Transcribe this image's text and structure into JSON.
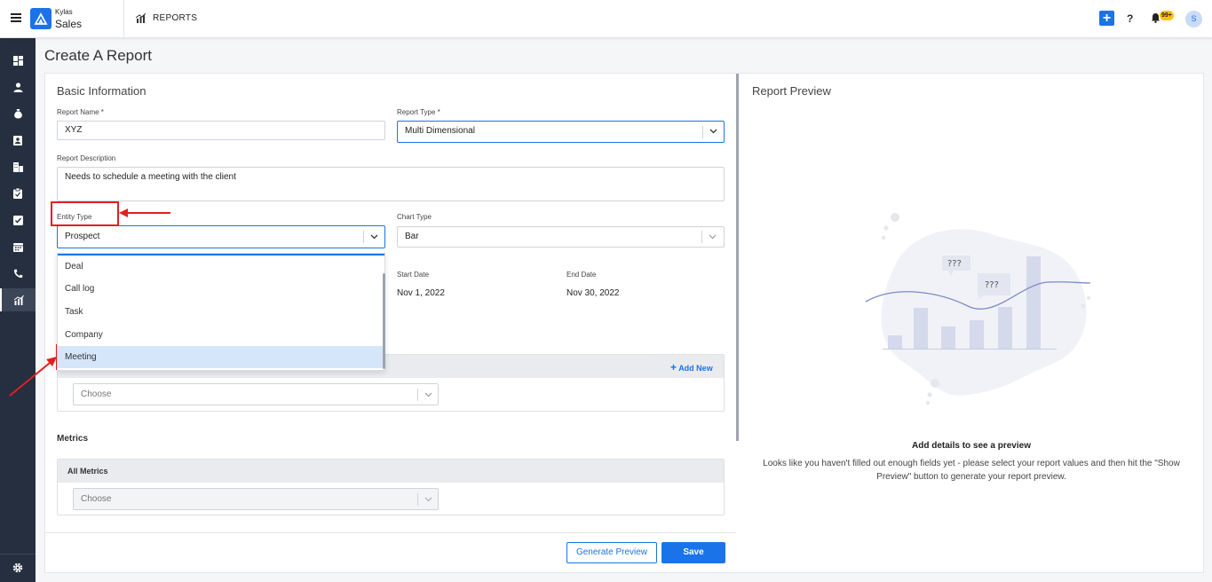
{
  "app": {
    "brand_top": "Kylas",
    "brand_main": "Sales",
    "module_title": "REPORTS",
    "notification_count": "99+",
    "avatar_initial": "S"
  },
  "sidebar": {
    "items": [
      {
        "name": "dashboard-icon"
      },
      {
        "name": "user-icon"
      },
      {
        "name": "money-bag-icon"
      },
      {
        "name": "contact-card-icon"
      },
      {
        "name": "building-icon"
      },
      {
        "name": "clipboard-icon"
      },
      {
        "name": "checkbox-icon"
      },
      {
        "name": "calendar-icon"
      },
      {
        "name": "phone-icon"
      },
      {
        "name": "reports-icon",
        "active": true
      }
    ],
    "bottom": "gear-icon"
  },
  "page": {
    "title": "Create A Report"
  },
  "basic_info": {
    "section_title": "Basic Information",
    "report_name_label": "Report Name *",
    "report_name_value": "XYZ",
    "report_type_label": "Report Type *",
    "report_type_value": "Multi Dimensional",
    "description_label": "Report Description",
    "description_value": "Needs to schedule a meeting with the client",
    "entity_type_label": "Entity Type",
    "entity_type_value": "Prospect",
    "chart_type_label": "Chart Type",
    "chart_type_value": "Bar",
    "start_date_label": "Start Date",
    "start_date_value": "Nov 1, 2022",
    "end_date_label": "End Date",
    "end_date_value": "Nov 30, 2022"
  },
  "entity_dropdown": {
    "options": [
      "Deal",
      "Call log",
      "Task",
      "Company",
      "Meeting"
    ],
    "highlighted": "Meeting"
  },
  "dimensions": {
    "add_new": "Add New",
    "select_placeholder": "Choose"
  },
  "metrics": {
    "section_title": "Metrics",
    "box_title": "All Metrics",
    "select_placeholder": "Choose"
  },
  "actions": {
    "generate_preview": "Generate Preview",
    "save": "Save"
  },
  "preview": {
    "title": "Report Preview",
    "bubble1": "???",
    "bubble2": "???",
    "empty_title": "Add details to see a preview",
    "empty_desc": "Looks like you haven't filled out enough fields yet - please select your report values and then hit the \"Show Preview\" button to generate your report preview."
  },
  "colors": {
    "accent": "#1a73e8",
    "sidebar_bg": "#262f3f",
    "annotation_red": "#e02020",
    "highlight": "#d6e6fa"
  }
}
